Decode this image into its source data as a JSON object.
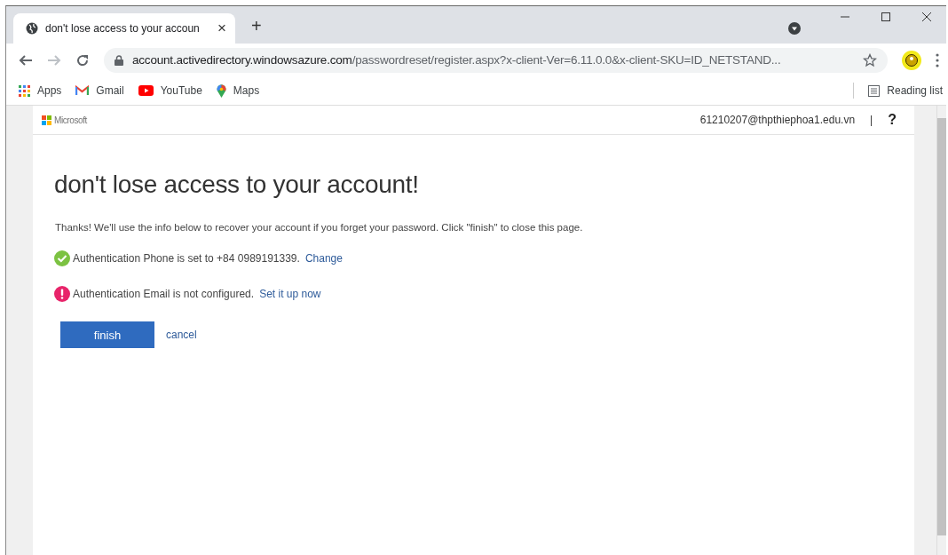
{
  "browser": {
    "tabs": [
      {
        "title": "don't lose access to your accoun",
        "selected": true
      }
    ],
    "new_tab": "+",
    "tab_close": "×",
    "address": {
      "host": "account.activedirectory.windowsazure.com",
      "path": "/passwordreset/register.aspx?x-client-Ver=6.11.0.0&x-client-SKU=ID_NETSTAND..."
    },
    "bookmarks": [
      {
        "label": "Apps",
        "kind": "apps"
      },
      {
        "label": "Gmail",
        "kind": "gmail"
      },
      {
        "label": "YouTube",
        "kind": "youtube"
      },
      {
        "label": "Maps",
        "kind": "maps"
      }
    ],
    "reading_list": "Reading list"
  },
  "page": {
    "brand": "Microsoft",
    "user": "61210207@thpthiephoa1.edu.vn",
    "separator": "|",
    "help": "?",
    "heading": "don't lose access to your account!",
    "intro": "Thanks! We'll use the info below to recover your account if you forget your password. Click \"finish\" to close this page.",
    "methods": [
      {
        "kind": "ok",
        "text": "Authentication Phone is set to +84 0989191339.",
        "link": "Change"
      },
      {
        "kind": "warning",
        "text": "Authentication Email is not configured.",
        "link": "Set it up now"
      }
    ],
    "finish": "finish",
    "cancel": "cancel"
  }
}
